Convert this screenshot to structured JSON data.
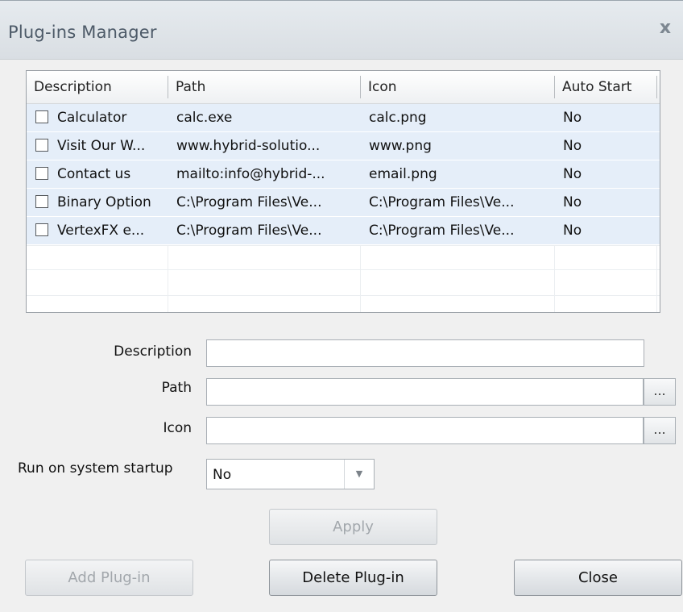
{
  "window": {
    "title": "Plug-ins Manager",
    "close_glyph": "x"
  },
  "grid": {
    "columns": [
      "Description",
      "Path",
      "Icon",
      "Auto Start"
    ],
    "rows": [
      {
        "description": "Calculator",
        "path": "calc.exe",
        "icon": "calc.png",
        "auto_start": "No",
        "checked": false
      },
      {
        "description": "Visit Our W...",
        "path": "www.hybrid-solutio...",
        "icon": "www.png",
        "auto_start": "No",
        "checked": false
      },
      {
        "description": "Contact us",
        "path": "mailto:info@hybrid-...",
        "icon": "email.png",
        "auto_start": "No",
        "checked": false
      },
      {
        "description": "Binary Option",
        "path": "C:\\Program Files\\Ve...",
        "icon": "C:\\Program Files\\Ve...",
        "auto_start": "No",
        "checked": false
      },
      {
        "description": "VertexFX e...",
        "path": "C:\\Program Files\\Ve...",
        "icon": "C:\\Program Files\\Ve...",
        "auto_start": "No",
        "checked": false
      }
    ]
  },
  "form": {
    "description_label": "Description",
    "description_value": "",
    "path_label": "Path",
    "path_value": "",
    "icon_label": "Icon",
    "icon_value": "",
    "browse_label": "...",
    "startup_label": "Run on system startup",
    "startup_value": "No"
  },
  "buttons": {
    "apply": "Apply",
    "add": "Add Plug-in",
    "delete": "Delete Plug-in",
    "close": "Close"
  },
  "colors": {
    "row_bg": "#e5eef9",
    "title_text": "#4d5a68",
    "disabled_text": "#a2a7ac"
  }
}
